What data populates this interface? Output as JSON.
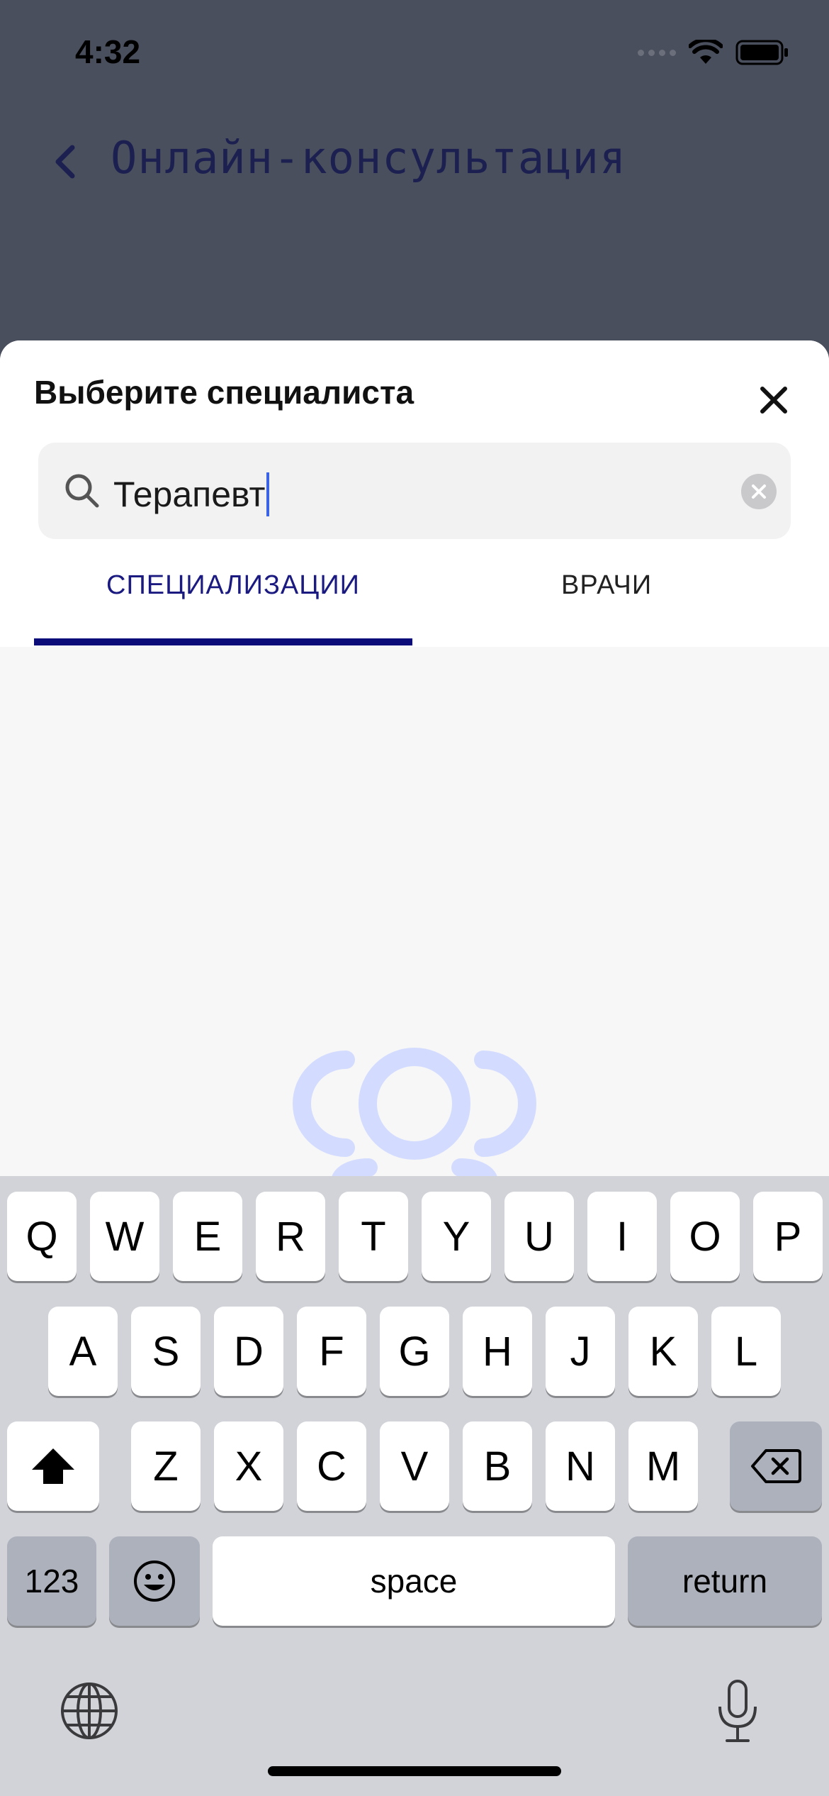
{
  "status_bar": {
    "time": "4:32"
  },
  "header": {
    "title": "Онлайн-консультация"
  },
  "sheet": {
    "title": "Выберите специалиста",
    "search": {
      "value": "Терапевт"
    },
    "tabs": [
      {
        "label": "СПЕЦИАЛИЗАЦИИ",
        "selected": true
      },
      {
        "label": "ВРАЧИ",
        "selected": false
      }
    ]
  },
  "keyboard": {
    "row1": [
      "Q",
      "W",
      "E",
      "R",
      "T",
      "Y",
      "U",
      "I",
      "O",
      "P"
    ],
    "row2": [
      "A",
      "S",
      "D",
      "F",
      "G",
      "H",
      "J",
      "K",
      "L"
    ],
    "row3": [
      "Z",
      "X",
      "C",
      "V",
      "B",
      "N",
      "M"
    ],
    "numbers_key": "123",
    "space_key": "space",
    "return_key": "return"
  },
  "colors": {
    "accent": "#0b0b7a",
    "caret": "#3b63e5",
    "loader": "#d3dcff"
  }
}
